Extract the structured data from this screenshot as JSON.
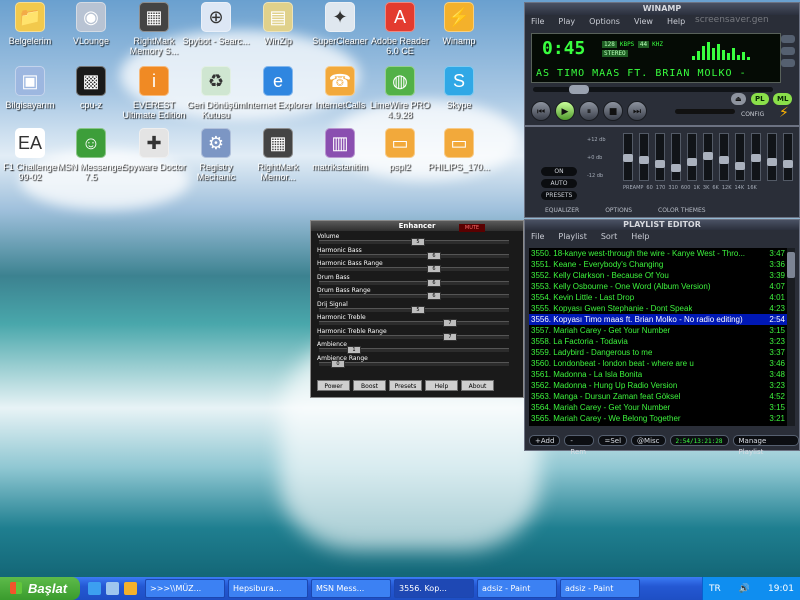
{
  "desktop": {
    "icons": [
      {
        "label": "Belgelerim",
        "glyph": "folder-icon",
        "color": "#f2c94c"
      },
      {
        "label": "VLounge",
        "glyph": "vlounge-icon",
        "color": "#b8c3d3"
      },
      {
        "label": "RightMark Memory S...",
        "glyph": "chip-icon",
        "color": "#444"
      },
      {
        "label": "Spybot - Searc...",
        "glyph": "spybot-icon",
        "color": "#dde7f5"
      },
      {
        "label": "WinZip",
        "glyph": "winzip-icon",
        "color": "#e0d18b"
      },
      {
        "label": "SuperCleaner",
        "glyph": "cleaner-icon",
        "color": "#dfe7ef"
      },
      {
        "label": "Adobe Reader 6.0 CE",
        "glyph": "pdf-icon",
        "color": "#e33b2f"
      },
      {
        "label": "Winamp",
        "glyph": "winamp-icon",
        "color": "#f4b12b"
      },
      {
        "label": "Bilgisayarım",
        "glyph": "computer-icon",
        "color": "#9db7e0"
      },
      {
        "label": "cpu-z",
        "glyph": "cpu-icon",
        "color": "#1a1a1a"
      },
      {
        "label": "EVEREST Ultimate Edition",
        "glyph": "info-icon",
        "color": "#f08a24"
      },
      {
        "label": "Geri Dönüşüm Kutusu",
        "glyph": "recycle-icon",
        "color": "#cfe6d1"
      },
      {
        "label": "Internet Explorer",
        "glyph": "ie-icon",
        "color": "#2f86e0"
      },
      {
        "label": "InternetCalls",
        "glyph": "calls-icon",
        "color": "#f2a93b"
      },
      {
        "label": "LimeWire PRO 4.9.28",
        "glyph": "limewire-icon",
        "color": "#52b148"
      },
      {
        "label": "Skype",
        "glyph": "skype-icon",
        "color": "#30a8e6"
      },
      {
        "label": "F1 Challenge 99-02",
        "glyph": "ea-icon",
        "color": "#fff"
      },
      {
        "label": "MSN Messenger 7.5",
        "glyph": "msn-icon",
        "color": "#3d9e3a"
      },
      {
        "label": "Spyware Doctor",
        "glyph": "doctor-icon",
        "color": "#e4e4e4"
      },
      {
        "label": "Registry Mechanic",
        "glyph": "registry-icon",
        "color": "#7c96c4"
      },
      {
        "label": "RightMark Memor...",
        "glyph": "chip-icon",
        "color": "#444"
      },
      {
        "label": "matrikstanitim",
        "glyph": "winrar-icon",
        "color": "#8a4fb0"
      },
      {
        "label": "pspl2",
        "glyph": "file-icon",
        "color": "#f2a93b"
      },
      {
        "label": "PHILIPS_170...",
        "glyph": "file-icon",
        "color": "#f2a93b"
      }
    ]
  },
  "winamp": {
    "title": "WINAMP",
    "menu": [
      "File",
      "Play",
      "Options",
      "View",
      "Help"
    ],
    "time": "0:45",
    "kbps": "KBPS",
    "kbps_val": "128",
    "khz": "KHZ",
    "khz_val": "44",
    "stereo": "STEREO",
    "marquee": "AS  TIMO MAAS FT. BRIAN MOLKO -",
    "config": "CONFIG",
    "pl_btn": "PL",
    "ml_btn": "ML",
    "accent": "#39ff3f"
  },
  "equalizer": {
    "labels": [
      "ON",
      "AUTO",
      "PRESETS"
    ],
    "freqs": [
      "PREAMP",
      "60",
      "170",
      "310",
      "600",
      "1K",
      "3K",
      "6K",
      "12K",
      "14K",
      "16K"
    ],
    "db": [
      "+12 db",
      "+0 db",
      "-12 db"
    ],
    "tabs": [
      "EQUALIZER",
      "OPTIONS",
      "COLOR THEMES"
    ],
    "watermark": "screensaver.gen"
  },
  "playlist": {
    "title": "PLAYLIST EDITOR",
    "menu": [
      "File",
      "Playlist",
      "Sort",
      "Help"
    ],
    "rows": [
      {
        "text": "3550. 18-kanye west-through the wire - Kanye West - Thro...",
        "time": "3:47"
      },
      {
        "text": "3551. Keane - Everybody's Changing",
        "time": "3:36"
      },
      {
        "text": "3552. Kelly Clarkson - Because Of You",
        "time": "3:39"
      },
      {
        "text": "3553. Kelly Osbourne - One Word (Album Version)",
        "time": "4:07"
      },
      {
        "text": "3554. Kevin Little - Last Drop",
        "time": "4:01"
      },
      {
        "text": "3555. Kopyası Gwen Stephanie - Dont Speak",
        "time": "4:23"
      },
      {
        "text": "3556. Kopyası Timo maas ft. Brian Molko - No radio editing)",
        "time": "2:54"
      },
      {
        "text": "3557. Mariah Carey - Get Your Number",
        "time": "3:15"
      },
      {
        "text": "3558. La Factoria - Todavia",
        "time": "3:23"
      },
      {
        "text": "3559. Ladybird - Dangerous to me",
        "time": "3:37"
      },
      {
        "text": "3560. Londonbeat - london beat - where are u",
        "time": "3:46"
      },
      {
        "text": "3561. Madonna - La Isla Bonita",
        "time": "3:48"
      },
      {
        "text": "3562. Madonna - Hung Up Radio Version",
        "time": "3:23"
      },
      {
        "text": "3563. Manga - Dursun Zaman feat Göksel",
        "time": "4:52"
      },
      {
        "text": "3564. Mariah Carey - Get Your Number",
        "time": "3:15"
      },
      {
        "text": "3565. Mariah Carey - We Belong Together",
        "time": "3:21"
      }
    ],
    "selected_index": 6,
    "footer": {
      "add": "+Add",
      "rem": "-Rem",
      "sel": "=Sel",
      "misc": "@Misc",
      "time": "2:54/13:21:28",
      "manage": "Manage Playlist"
    }
  },
  "enhancer": {
    "title": "Enhancer",
    "mute": "MUTE",
    "rows": [
      {
        "label": "Volume",
        "value": "5"
      },
      {
        "label": "Harmonic Bass",
        "value": "6"
      },
      {
        "label": "Harmonic Bass Range",
        "value": "6"
      },
      {
        "label": "Drum Bass",
        "value": "6"
      },
      {
        "label": "Drum Bass Range",
        "value": "6"
      },
      {
        "label": "Drij Signal",
        "value": "5"
      },
      {
        "label": "Harmonic Treble",
        "value": "7"
      },
      {
        "label": "Harmonic Treble Range",
        "value": "7"
      },
      {
        "label": "Ambience",
        "value": "1"
      },
      {
        "label": "Ambience Range",
        "value": "0"
      }
    ],
    "buttons": [
      "Power",
      "Boost",
      "Presets",
      "Help",
      "About"
    ]
  },
  "taskbar": {
    "start": "Başlat",
    "tasks": [
      ">>>\\\\MÜZ...",
      "Hepsibura...",
      "MSN Mess...",
      "3556. Kop...",
      "adsiz - Paint",
      "adsiz - Paint"
    ],
    "active_task": 3,
    "tray_lang": "TR",
    "clock": "19:01"
  }
}
